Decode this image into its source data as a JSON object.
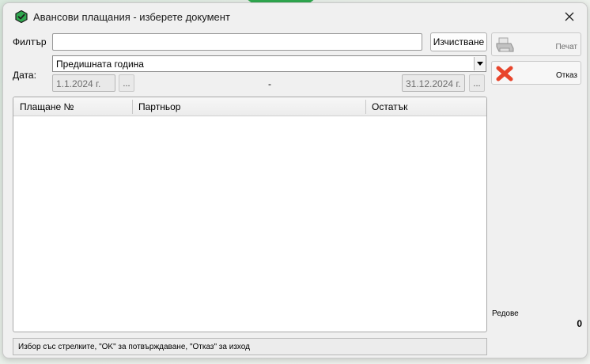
{
  "window": {
    "title": "Авансови плащания - изберете документ"
  },
  "filter": {
    "label": "Филтър",
    "value": "",
    "placeholder": "",
    "clear_label": "Изчистване"
  },
  "date": {
    "label": "Дата:",
    "period_selected": "Предишната година",
    "from": "1.1.2024 г.",
    "to": "31.12.2024 г.",
    "picker_label": "...",
    "separator": "-"
  },
  "table": {
    "columns": [
      "Плащане №",
      "Партньор",
      "Остатък"
    ],
    "rows": []
  },
  "actions": {
    "print_label": "Печат",
    "cancel_label": "Отказ"
  },
  "rows_summary": {
    "label": "Редове",
    "count": "0"
  },
  "status_text": "Избор със стрелките, \"OK\" за потвърждаване, \"Отказ\" за изход",
  "colors": {
    "accent_green": "#2fa84f",
    "cancel_red": "#e8452c"
  },
  "icons": {
    "app": "app-logo-icon",
    "close": "close-icon",
    "print": "printer-icon",
    "cancel": "cancel-x-icon",
    "dropdown": "chevron-down-icon"
  }
}
